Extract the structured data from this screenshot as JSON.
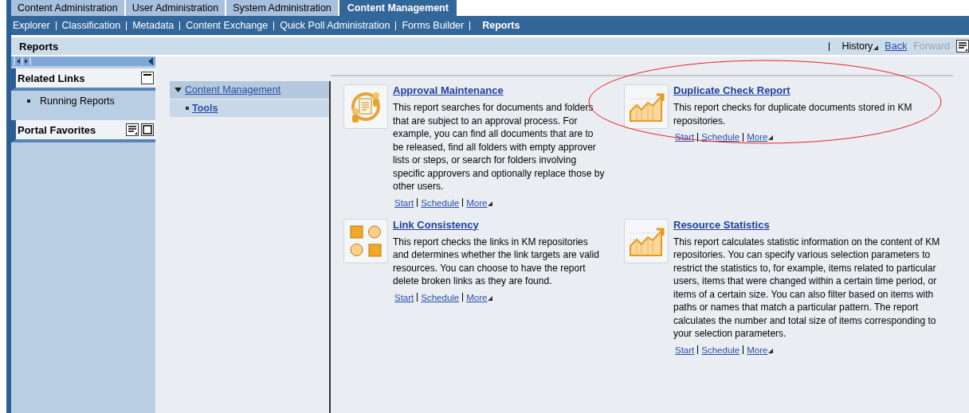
{
  "top_tabs": [
    {
      "label": "Content Administration",
      "selected": false
    },
    {
      "label": "User Administration",
      "selected": false
    },
    {
      "label": "System Administration",
      "selected": false
    },
    {
      "label": "Content Management",
      "selected": true
    }
  ],
  "sub_nav": [
    {
      "label": "Explorer",
      "selected": false
    },
    {
      "label": "Classification",
      "selected": false
    },
    {
      "label": "Metadata",
      "selected": false
    },
    {
      "label": "Content Exchange",
      "selected": false
    },
    {
      "label": "Quick Poll Administration",
      "selected": false
    },
    {
      "label": "Forms Builder",
      "selected": false
    },
    {
      "label": "Reports",
      "selected": true
    }
  ],
  "page_title": "Reports",
  "history": {
    "label": "History",
    "back": {
      "label": "Back",
      "disabled": false
    },
    "forward": {
      "label": "Forward",
      "disabled": true
    }
  },
  "sidebar": {
    "panels": [
      {
        "title": "Related Links",
        "expanded": true,
        "items": [
          "Running Reports"
        ]
      },
      {
        "title": "Portal Favorites",
        "expanded": false
      }
    ]
  },
  "tree": {
    "root": {
      "label": "Content Management",
      "expanded": true,
      "children": [
        {
          "label": "Tools",
          "selected": true
        }
      ]
    }
  },
  "reports": [
    {
      "title": "Approval Maintenance",
      "kind": "approval",
      "highlighted": false,
      "description": "This report searches for documents and folders that are subject to an approval process. For example, you can find all documents that are to be released, find all folders with empty approver lists or steps, or search for folders involving specific approvers and optionally replace those by other users.",
      "links": [
        "Start",
        "Schedule",
        "More"
      ]
    },
    {
      "title": "Duplicate Check Report",
      "kind": "chart",
      "highlighted": true,
      "description": "This report checks for duplicate documents stored in KM repositories.",
      "links": [
        "Start",
        "Schedule",
        "More"
      ]
    },
    {
      "title": "Link Consistency",
      "kind": "shapes",
      "highlighted": false,
      "description": "This report checks the links in KM repositories and determines whether the link targets are valid resources. You can choose to have the report delete broken links as they are found.",
      "links": [
        "Start",
        "Schedule",
        "More"
      ]
    },
    {
      "title": "Resource Statistics",
      "kind": "chart",
      "highlighted": false,
      "description": "This report calculates statistic information on the content of KM repositories. You can specify various selection parameters to restrict the statistics to, for example, items related to particular users, items that were changed within a certain time period, or items of a certain size. You can also filter based on items with paths or names that match a particular pattern. The report calculates the number and total size of items corresponding to your selection parameters.",
      "links": [
        "Start",
        "Schedule",
        "More"
      ]
    }
  ]
}
